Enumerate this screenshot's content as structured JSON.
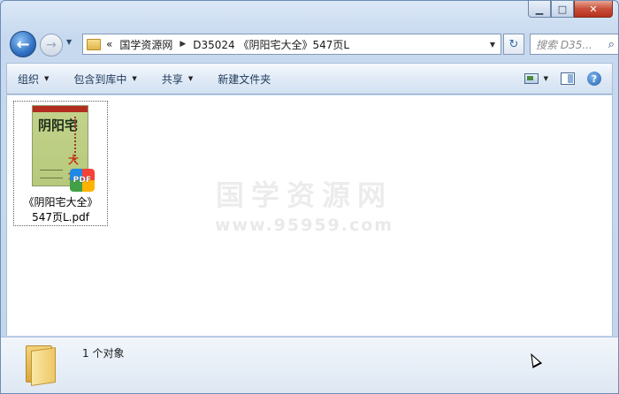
{
  "window": {
    "caption": {
      "minimize": "▁",
      "maximize": "□",
      "close": "✕"
    }
  },
  "nav": {
    "back_glyph": "←",
    "forward_glyph": "→",
    "history_glyph": "▼"
  },
  "address": {
    "overflow": "«",
    "crumbs": [
      "国学资源网",
      "D35024 《阴阳宅大全》547页L"
    ],
    "separator": "▶",
    "dropdown": "▼",
    "refresh_glyph": "↻"
  },
  "search": {
    "placeholder": "搜索 D35...",
    "icon": "search-icon"
  },
  "toolbar": {
    "organize": "组织",
    "include_library": "包含到库中",
    "share": "共享",
    "new_folder": "新建文件夹",
    "arrow": "▼",
    "help": "?"
  },
  "file": {
    "name_line1": "《阴阳宅大全》",
    "name_line2": "547页L.pdf",
    "cover_title": "阴阳宅",
    "cover_stamp": "大全",
    "badge": "PDF"
  },
  "watermark": {
    "site_cn": "国学资源网",
    "url": "www.95959.com"
  },
  "details": {
    "count": "1 个对象"
  }
}
